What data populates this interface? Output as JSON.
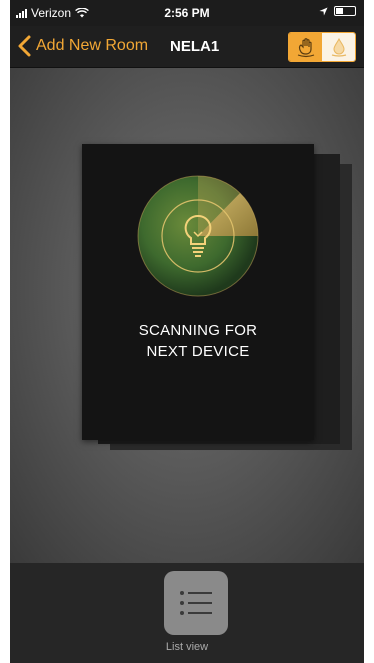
{
  "status_bar": {
    "carrier": "Verizon",
    "time": "2:56 PM"
  },
  "nav": {
    "back_label": "Add New Room",
    "title": "NELA1",
    "accent_color": "#f2a735"
  },
  "scanner": {
    "line1": "SCANNING FOR",
    "line2": "NEXT DEVICE",
    "icon": "lightbulb-icon"
  },
  "bottom": {
    "list_view_label": "List view",
    "icon": "list-icon"
  }
}
